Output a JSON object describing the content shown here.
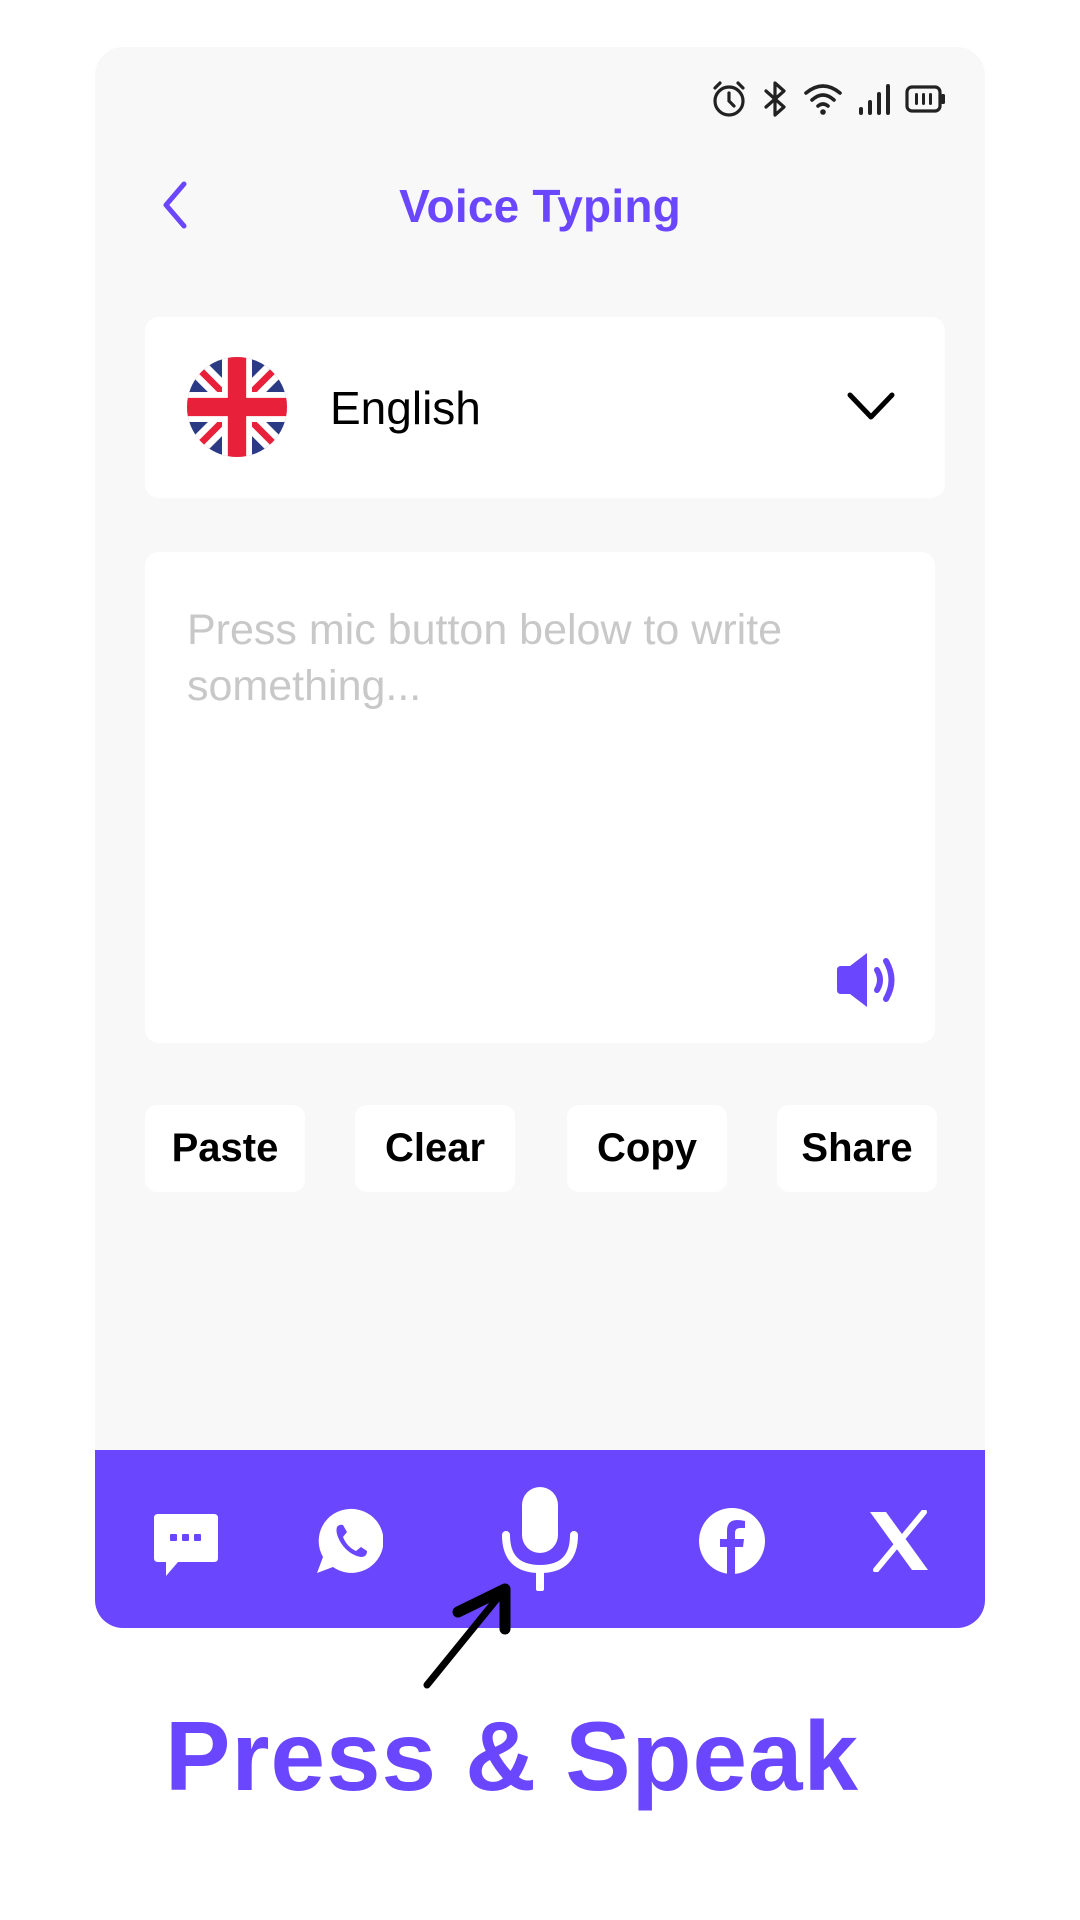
{
  "status_bar": {
    "icons": [
      "alarm-icon",
      "bluetooth-icon",
      "wifi-icon",
      "signal-icon",
      "battery-icon"
    ]
  },
  "header": {
    "back_icon": "chevron-left-icon",
    "title": "Voice Typing"
  },
  "language_selector": {
    "flag_icon": "uk-flag-icon",
    "selected_language": "English",
    "dropdown_icon": "chevron-down-icon"
  },
  "text_area": {
    "value": "",
    "placeholder": "Press mic button below to write something...",
    "speaker_icon": "speaker-icon"
  },
  "actions": [
    {
      "label": "Paste"
    },
    {
      "label": "Clear"
    },
    {
      "label": "Copy"
    },
    {
      "label": "Share"
    }
  ],
  "bottom_bar": {
    "items": [
      {
        "icon": "message-icon",
        "label": "SMS"
      },
      {
        "icon": "whatsapp-icon",
        "label": "WhatsApp"
      },
      {
        "icon": "microphone-icon",
        "label": "Microphone"
      },
      {
        "icon": "facebook-icon",
        "label": "Facebook"
      },
      {
        "icon": "x-icon",
        "label": "X"
      }
    ]
  },
  "annotation": {
    "caption": "Press & Speak",
    "arrow_icon": "arrow-up-right-icon"
  },
  "colors": {
    "accent": "#6b46ff",
    "background": "#f8f8f8",
    "card": "#ffffff",
    "placeholder": "#c8c8c8"
  }
}
